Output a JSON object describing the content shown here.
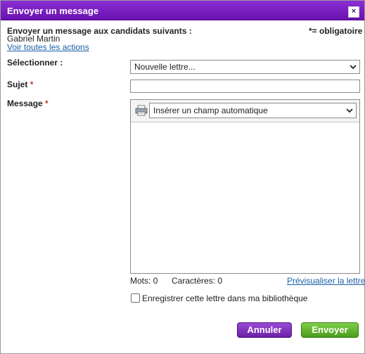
{
  "window": {
    "title": "Envoyer un message",
    "close_symbol": "×"
  },
  "header": {
    "intro": "Envoyer un message aux candidats suivants :",
    "recipient": "Gabriel Martin",
    "actions_link": "Voir toutes les actions",
    "required_note": "*= obligatoire"
  },
  "form": {
    "select_label": "Sélectionner :",
    "select_value": "Nouvelle lettre...",
    "subject_label": "Sujet",
    "subject_value": "",
    "message_label": "Message",
    "required_star": "*",
    "autofield_select": "Insérer un champ automatique",
    "message_body": ""
  },
  "stats": {
    "words_label": "Mots:",
    "words_value": "0",
    "chars_label": "Caractères:",
    "chars_value": "0",
    "preview_link": "Prévisualiser la lettre"
  },
  "save_checkbox": {
    "label": "Enregistrer cette lettre dans ma bibliothèque",
    "checked": false
  },
  "buttons": {
    "cancel": "Annuler",
    "send": "Envoyer"
  },
  "colors": {
    "titlebar": "#7a22c4",
    "cancel": "#7e2fbe",
    "send": "#5fae2e",
    "link": "#1a5fa8",
    "required": "#c0392b"
  }
}
